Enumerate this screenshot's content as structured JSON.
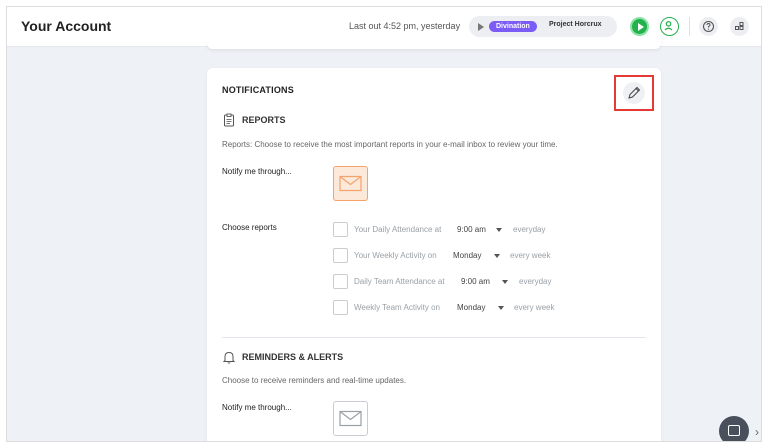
{
  "header": {
    "title": "Your Account",
    "last_out": "Last out 4:52 pm, yesterday",
    "timer": {
      "project": "Divination",
      "task": "Project Horcrux"
    },
    "colors": {
      "start": "#22b14c",
      "badge": "#7b5cf5"
    },
    "icons": [
      "play-icon",
      "user-icon",
      "help-icon",
      "apps-icon"
    ]
  },
  "notifications": {
    "title": "NOTIFICATIONS",
    "edit_icon": "pencil-icon",
    "reports": {
      "heading": "REPORTS",
      "icon": "clipboard-icon",
      "description": "Reports: Choose to receive the most important reports in your e-mail inbox to review your time.",
      "notify_label": "Notify me through...",
      "channel_icon": "email-icon",
      "choose_label": "Choose reports",
      "items": [
        {
          "text": "Your Daily Attendance at",
          "value": "9:00 am",
          "freq": "everyday"
        },
        {
          "text": "Your Weekly Activity on",
          "value": "Monday",
          "freq": "every week"
        },
        {
          "text": "Daily Team Attendance at",
          "value": "9:00 am",
          "freq": "everyday"
        },
        {
          "text": "Weekly Team Activity on",
          "value": "Monday",
          "freq": "every week"
        }
      ]
    },
    "reminders": {
      "heading": "REMINDERS & ALERTS",
      "icon": "bell-icon",
      "description": "Choose to receive reminders and real-time updates.",
      "notify_label": "Notify me through...",
      "channel_icon": "email-icon"
    }
  },
  "widgets": {
    "chat_icon": "chat-icon",
    "arrow_icon": "chevron-right-icon"
  }
}
